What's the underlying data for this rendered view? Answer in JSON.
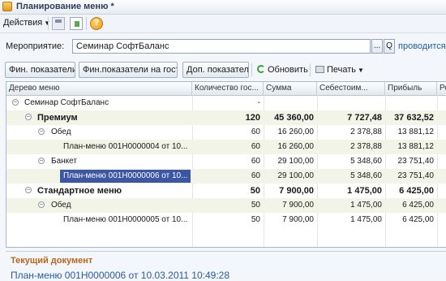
{
  "window": {
    "title": "Планирование меню *"
  },
  "menubar": {
    "actions_label": "Действия",
    "help_glyph": "?"
  },
  "event": {
    "label": "Мероприятие:",
    "value": "Семинар СофтБаланс",
    "select_glyph": "...",
    "open_glyph": "Q",
    "link": "проводится с 1"
  },
  "toolbar": {
    "fin_indicators": "Фин. показатели",
    "fin_per_guest": "Фин.показатели на гостя",
    "extra_indicators": "Доп. показатели",
    "refresh": "Обновить",
    "print": "Печать"
  },
  "columns": [
    "Дерево меню",
    "Количество гос...",
    "Сумма",
    "Себестоим...",
    "Прибыль",
    "Рент"
  ],
  "rows": [
    {
      "name": "Семинар СофтБаланс",
      "qty": "-",
      "sum": "",
      "cost": "",
      "profit": ""
    },
    {
      "name": "Премиум",
      "qty": "120",
      "sum": "45 360,00",
      "cost": "7 727,48",
      "profit": "37 632,52"
    },
    {
      "name": "Обед",
      "qty": "60",
      "sum": "16 260,00",
      "cost": "2 378,88",
      "profit": "13 881,12"
    },
    {
      "name": "План-меню 001Н0000004 от 10...",
      "qty": "60",
      "sum": "16 260,00",
      "cost": "2 378,88",
      "profit": "13 881,12"
    },
    {
      "name": "Банкет",
      "qty": "60",
      "sum": "29 100,00",
      "cost": "5 348,60",
      "profit": "23 751,40"
    },
    {
      "name": "План-меню 001Н0000006 от 10...",
      "qty": "60",
      "sum": "29 100,00",
      "cost": "5 348,60",
      "profit": "23 751,40"
    },
    {
      "name": "Стандартное меню",
      "qty": "50",
      "sum": "7 900,00",
      "cost": "1 475,00",
      "profit": "6 425,00"
    },
    {
      "name": "Обед",
      "qty": "50",
      "sum": "7 900,00",
      "cost": "1 475,00",
      "profit": "6 425,00"
    },
    {
      "name": "План-меню 001Н0000005 от 10...",
      "qty": "50",
      "sum": "7 900,00",
      "cost": "1 475,00",
      "profit": "6 425,00"
    }
  ],
  "current_document": {
    "label": "Текущий документ",
    "value": "План-меню 001Н0000006 от 10.03.2011 10:49:28"
  },
  "colors": {
    "selection": "#3c56a6",
    "row_alt": "#f2f4e8",
    "accent_label": "#b9651d",
    "link": "#2a5aa8"
  }
}
